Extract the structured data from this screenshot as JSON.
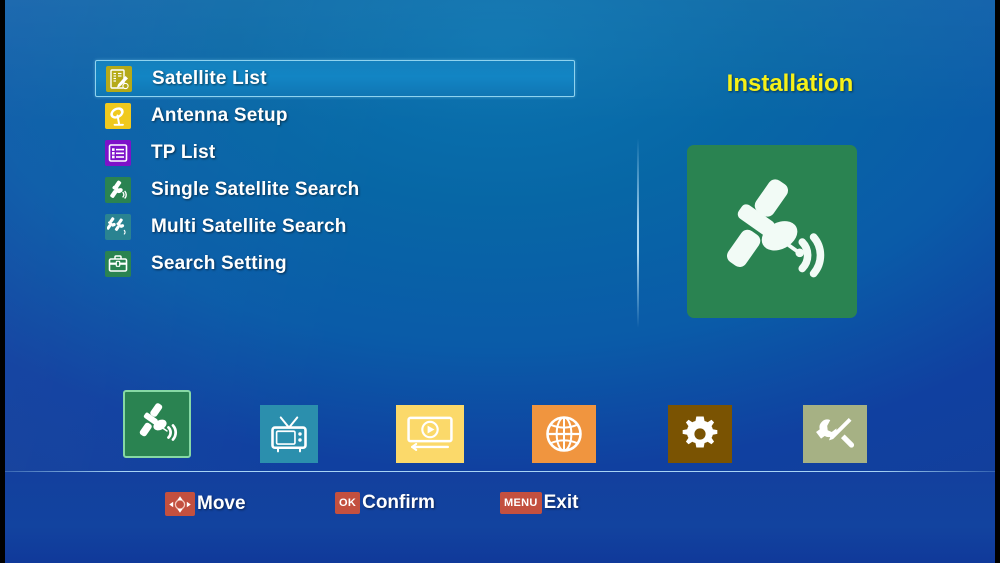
{
  "panel": {
    "title": "Installation",
    "image_icon": "satellite-dish-icon",
    "image_bg": "#2a8351"
  },
  "menu": {
    "selected_index": 0,
    "items": [
      {
        "label": "Satellite List",
        "icon": "satellite-list-icon",
        "icon_bg": "#b5aa18",
        "selected": true
      },
      {
        "label": "Antenna Setup",
        "icon": "antenna-dish-icon",
        "icon_bg": "#f0c91e",
        "selected": false
      },
      {
        "label": "TP List",
        "icon": "tp-list-icon",
        "icon_bg": "#7d12c9",
        "selected": false
      },
      {
        "label": "Single Satellite Search",
        "icon": "single-satellite-icon",
        "icon_bg": "#2a8351",
        "selected": false
      },
      {
        "label": "Multi Satellite Search",
        "icon": "multi-satellite-icon",
        "icon_bg": "#2a8391",
        "selected": false
      },
      {
        "label": "Search Setting",
        "icon": "toolbox-icon",
        "icon_bg": "#2a8351",
        "selected": false
      }
    ]
  },
  "strip": {
    "selected_index": 0,
    "items": [
      {
        "name": "installation",
        "icon": "satellite-dish-icon",
        "bg": "#2a8351",
        "selected": true
      },
      {
        "name": "channel",
        "icon": "tv-icon",
        "bg": "#2b8fad",
        "selected": false
      },
      {
        "name": "media",
        "icon": "media-player-icon",
        "bg": "#fbd96a",
        "selected": false
      },
      {
        "name": "network",
        "icon": "globe-icon",
        "bg": "#f0953f",
        "selected": false
      },
      {
        "name": "settings",
        "icon": "gear-icon",
        "bg": "#7a5302",
        "selected": false
      },
      {
        "name": "tools",
        "icon": "tools-icon",
        "bg": "#a6b184",
        "selected": false
      }
    ]
  },
  "hints": [
    {
      "key": "dpad",
      "key_label": "",
      "label": "Move"
    },
    {
      "key": "text",
      "key_label": "OK",
      "label": "Confirm"
    },
    {
      "key": "text",
      "key_label": "MENU",
      "label": "Exit"
    }
  ],
  "colors": {
    "accent_yellow": "#f6f018",
    "highlight_blue": "#1285c4",
    "highlight_border": "#8fd3ef",
    "key_red": "#c3503f",
    "bottom_bar": "#12439f"
  }
}
